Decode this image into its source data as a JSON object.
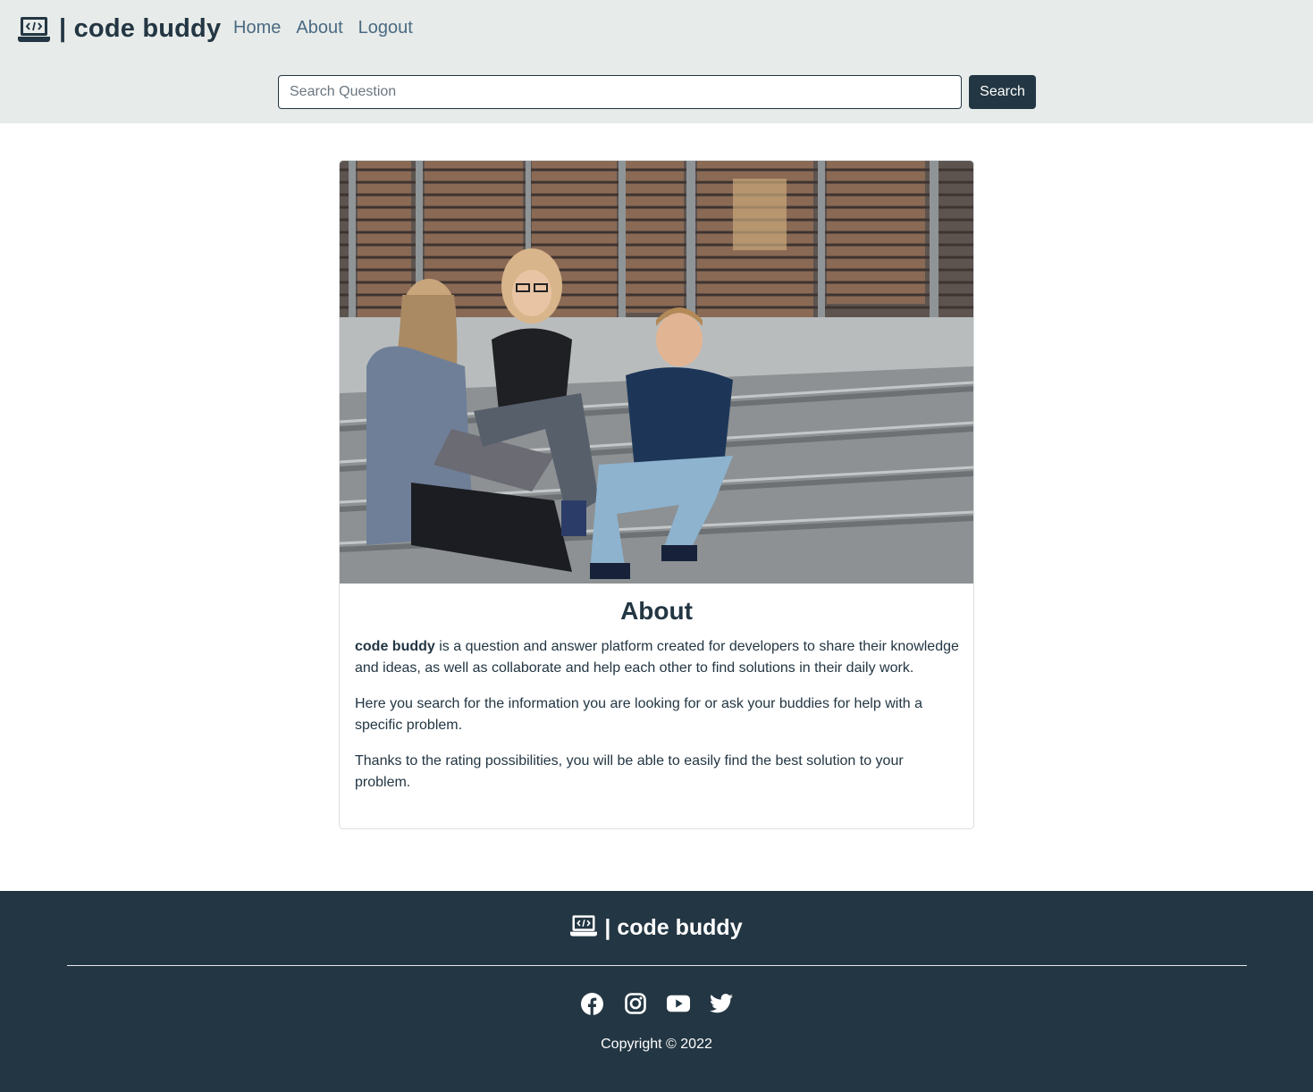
{
  "header": {
    "brand": "| code buddy",
    "nav": [
      {
        "label": "Home"
      },
      {
        "label": "About"
      },
      {
        "label": "Logout"
      }
    ],
    "search": {
      "placeholder": "Search Question",
      "button_label": "Search"
    }
  },
  "card": {
    "image_icon": "photo-of-three-people-on-steps",
    "title": "About",
    "paragraph1_bold": "code buddy",
    "paragraph1_rest": " is a question and answer platform created for developers to share their knowledge and ideas, as well as collaborate and help each other to find solutions in their daily work.",
    "paragraph2": "Here you search for the information you are looking for or ask your buddies for help with a specific problem.",
    "paragraph3": "Thanks to the rating possibilities, you will be able to easily find the best solution to your problem."
  },
  "footer": {
    "brand": "| code buddy",
    "socials": [
      "facebook-icon",
      "instagram-icon",
      "youtube-icon",
      "twitter-icon"
    ],
    "copyright": "Copyright © 2022"
  },
  "colors": {
    "primary": "#233643",
    "header_bg": "#e7ebe9",
    "nav_link": "#4a6a82"
  }
}
